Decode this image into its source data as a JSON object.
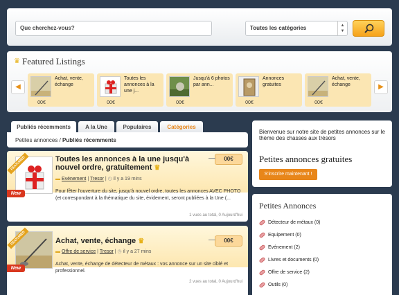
{
  "search": {
    "placeholder": "Que cherchez-vous?",
    "category_selected": "Toutes les catégories"
  },
  "featured": {
    "title": "Featured Listings",
    "items": [
      {
        "title": "Achat, vente, échange",
        "price": "00€"
      },
      {
        "title": "Toutes les annonces à la une j...",
        "price": "00€"
      },
      {
        "title": "Jusqu'à 6 photos par ann...",
        "price": "00€"
      },
      {
        "title": "Annonces gratuites",
        "price": "00€"
      },
      {
        "title": "Achat, vente, échange",
        "price": "00€"
      }
    ]
  },
  "tabs": [
    "Publiés récemments",
    "A la Une",
    "Populaires",
    "Catégories"
  ],
  "breadcrumb": {
    "root": "Petites annonces",
    "sep": " / ",
    "current": "Publiés récemments"
  },
  "listings": [
    {
      "ribbon": "FEATURED",
      "badge": "New",
      "title": "Toutes les annonces à la une jusqu'à nouvel ordre, gratuitement",
      "category": "Evénement",
      "author": "Tresor",
      "time": "il y a 19 mins",
      "price": "00€",
      "description": "Pour fêter l'ouverture du site, jusqu'à nouvel ordre, toutes les annonces AVEC PHOTO (et correspondant à la thématique du site, évidement, seront publiées à la Une (...",
      "stats": "1 vues au total, 0 Aujourd'hui"
    },
    {
      "ribbon": "FEATURED",
      "badge": "New",
      "title": "Achat, vente, échange",
      "category": "Offre de service",
      "author": "Tresor",
      "time": "il y a 27 mins",
      "price": "00€",
      "description": "Achat, vente, échange de détecteur de métaux : vos annonce sur un site ciblé et professionnel.",
      "stats": "2 vues au total, 0 Aujourd'hui"
    }
  ],
  "welcome": {
    "text": "Bienvenue sur notre site de petites annonces sur le thème des chasses aux trésors",
    "title": "Petites annonces gratuites",
    "button": "S'inscrire maintenant !"
  },
  "categories": {
    "title": "Petites Annonces",
    "items": [
      "Détecteur de métaux (0)",
      "Equipement (0)",
      "Evénement (2)",
      "Livres et documents (0)",
      "Offre de service (2)",
      "Outils (0)"
    ]
  },
  "colors": {
    "accent": "#e8861a",
    "background": "#2b3b4f",
    "featured_card": "#fbe6b3"
  }
}
